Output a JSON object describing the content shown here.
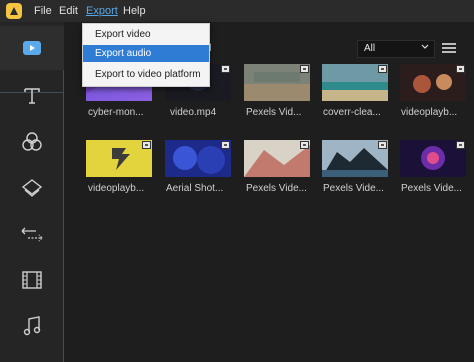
{
  "menubar": {
    "items": [
      {
        "label": "File"
      },
      {
        "label": "Edit"
      },
      {
        "label": "Export"
      },
      {
        "label": "Help"
      }
    ],
    "active_index": 2
  },
  "export_menu": {
    "items": [
      {
        "label": "Export video"
      },
      {
        "label": "Export audio"
      },
      {
        "label": "Export to video platform"
      }
    ],
    "highlighted_index": 1
  },
  "header_partial_text": "d",
  "filter": {
    "value": "All",
    "options_visible": [
      "All"
    ]
  },
  "sidebar": {
    "items": [
      {
        "icon": "video-media-icon",
        "selected": true
      },
      {
        "icon": "text-icon"
      },
      {
        "icon": "filters-icon"
      },
      {
        "icon": "overlays-icon"
      },
      {
        "icon": "transitions-icon"
      },
      {
        "icon": "elements-icon"
      },
      {
        "icon": "music-icon"
      }
    ]
  },
  "media": [
    {
      "caption": "cyber-mon..."
    },
    {
      "caption": "video.mp4"
    },
    {
      "caption": "Pexels Vid..."
    },
    {
      "caption": "coverr-clea..."
    },
    {
      "caption": "videoplayb..."
    },
    {
      "caption": "videoplayb..."
    },
    {
      "caption": "Aerial Shot..."
    },
    {
      "caption": "Pexels Vide..."
    },
    {
      "caption": "Pexels Vide..."
    },
    {
      "caption": "Pexels Vide..."
    }
  ],
  "thumbnail_colors": {
    "accent": "#58a6e6",
    "highlight": "#2f7cd5",
    "logo": "#f5c542"
  }
}
